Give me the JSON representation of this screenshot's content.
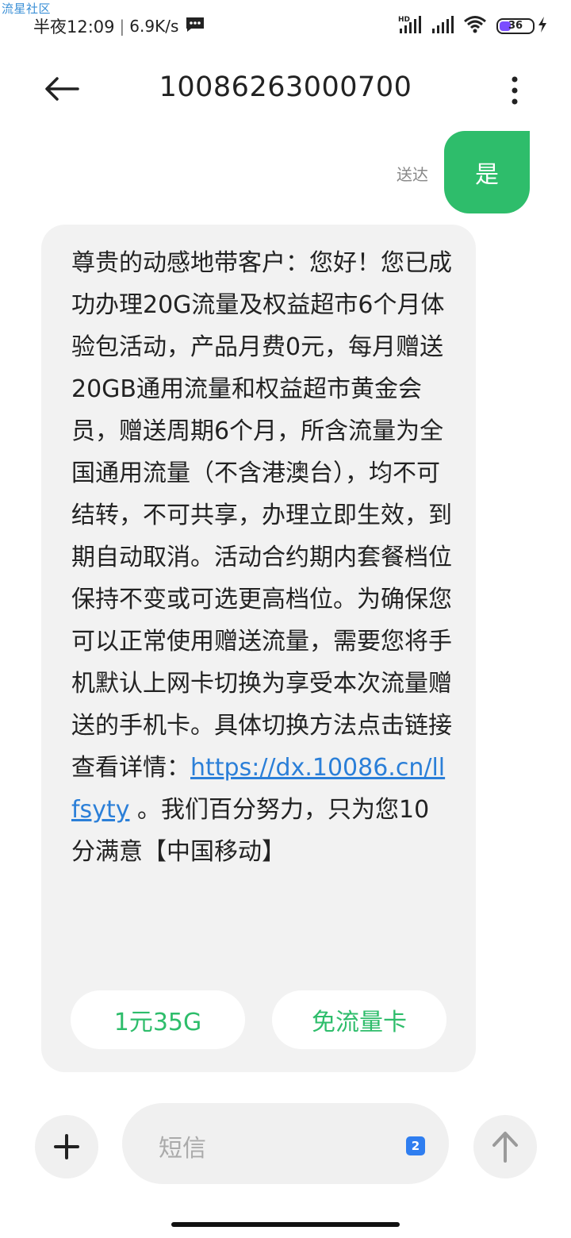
{
  "watermark": "流星社区",
  "status_bar": {
    "time": "半夜12:09",
    "separator": "|",
    "speed": "6.9K/s",
    "battery_level": "36",
    "battery_fraction": 0.36,
    "icons": [
      "message-icon",
      "hd-signal-icon",
      "signal-icon",
      "wifi-icon",
      "battery-icon",
      "charging-icon"
    ]
  },
  "header": {
    "title": "10086263000700",
    "back_icon": "back-arrow-icon",
    "more_icon": "more-vertical-icon"
  },
  "sent_message": {
    "status": "送达",
    "text": "是"
  },
  "received_message": {
    "text_before_link": "尊贵的动感地带客户：您好！您已成功办理20G流量及权益超市6个月体验包活动，产品月费0元，每月赠送20GB通用流量和权益超市黄金会员，赠送周期6个月，所含流量为全国通用流量（不含港澳台），均不可结转，不可共享，办理立即生效，到期自动取消。活动合约期内套餐档位保持不变或可选更高档位。为确保您可以正常使用赠送流量，需要您将手机默认上网卡切换为享受本次流量赠送的手机卡。具体切换方法点击链接查看详情：",
    "link": "https://dx.10086.cn/llfsyty",
    "text_after_link": " 。我们百分努力，只为您10分满意【中国移动】",
    "quick_replies": [
      "1元35G",
      "免流量卡"
    ]
  },
  "input_bar": {
    "placeholder": "短信",
    "sim_badge": "2",
    "add_icon": "plus-icon",
    "send_icon": "send-arrow-icon"
  },
  "colors": {
    "accent_green": "#2ebd6b",
    "link_blue": "#2b7fd8",
    "bubble_gray": "#f2f2f2",
    "battery_purple": "#7b4dff"
  }
}
